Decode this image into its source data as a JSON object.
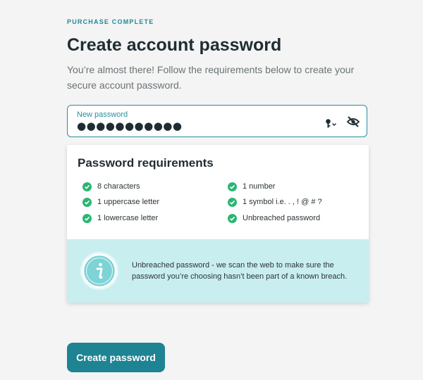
{
  "header": {
    "eyebrow": "PURCHASE COMPLETE",
    "title": "Create account password",
    "subtitle": "You’re almost there! Follow the requirements below to create your secure account password."
  },
  "password_field": {
    "label": "New password",
    "masked_value": "●●●●●●●●●●●",
    "key_icon": "key-dropdown-icon",
    "visibility_icon": "eye-slash-icon"
  },
  "requirements": {
    "title": "Password requirements",
    "check_icon": "check-circle-icon",
    "check_color": "#2bb673",
    "items": [
      {
        "label": "8 characters",
        "met": true
      },
      {
        "label": "1 number",
        "met": true
      },
      {
        "label": "1 uppercase letter",
        "met": true
      },
      {
        "label": "1 symbol i.e. . , ! @ # ?",
        "met": true
      },
      {
        "label": "1 lowercase letter",
        "met": true
      },
      {
        "label": "Unbreached password",
        "met": true
      }
    ],
    "info": {
      "icon": "info-icon",
      "text": "Unbreached password - we scan the web to make sure the password you’re choosing hasn’t been part of a known breach."
    }
  },
  "actions": {
    "create_label": "Create password"
  },
  "colors": {
    "accent": "#1e8393",
    "info_background": "#c9eef0",
    "page_background": "#f4f4f4"
  }
}
